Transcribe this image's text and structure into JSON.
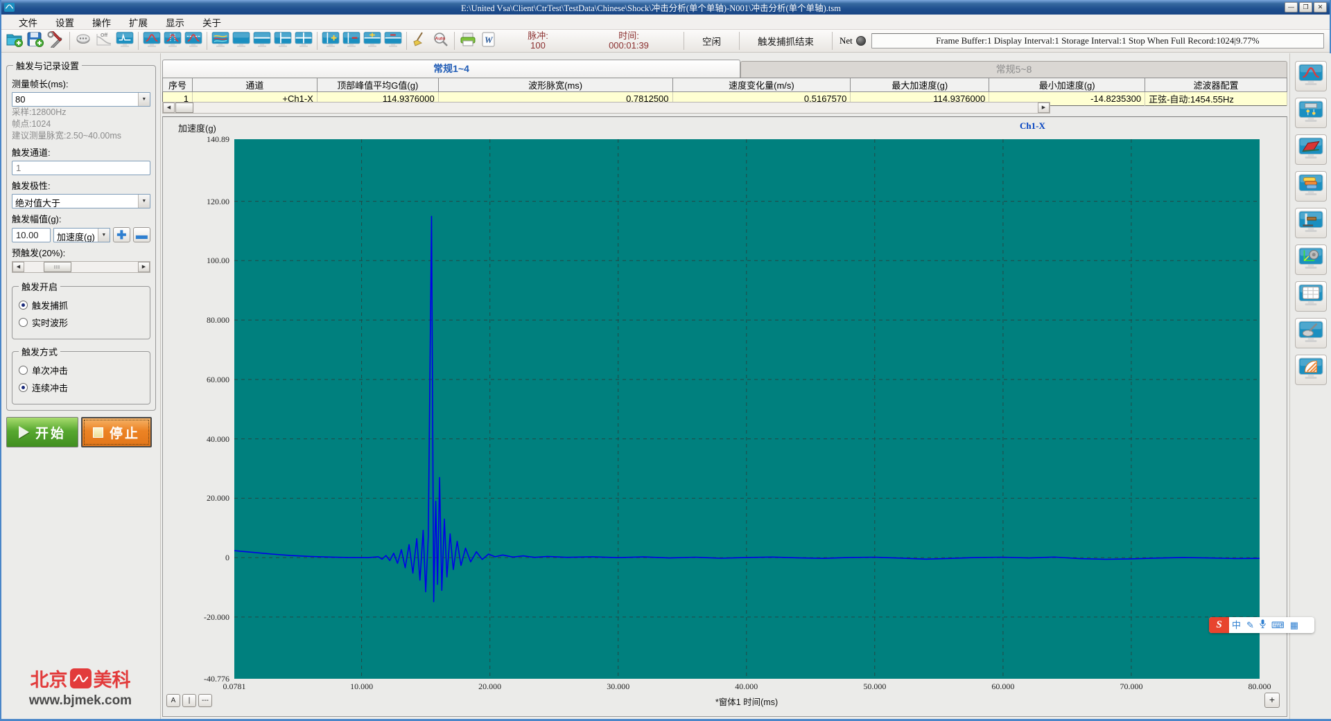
{
  "window": {
    "title": "E:\\United Vsa\\Client\\CtrTest\\TestData\\Chinese\\Shock\\冲击分析(单个单轴)-N001\\冲击分析(单个单轴).tsm",
    "buttons": {
      "minimize": "—",
      "maximize": "❒",
      "close": "✕"
    }
  },
  "menu": {
    "items": [
      "文件",
      "设置",
      "操作",
      "扩展",
      "显示",
      "关于"
    ]
  },
  "toolbar": {
    "buttons": [
      {
        "icon": "open-folder-icon",
        "name": "open-button"
      },
      {
        "icon": "save-icon",
        "name": "save-button"
      },
      {
        "icon": "tools-icon",
        "name": "config-tools-button"
      },
      {
        "sep": true
      },
      {
        "icon": "connector-icon",
        "name": "hardware-connect-button"
      },
      {
        "icon": "off-curve-icon",
        "name": "output-off-button"
      },
      {
        "icon": "scope-screen-icon",
        "name": "scope-window-button"
      },
      {
        "sep": true
      },
      {
        "icon": "peak-screen-icon",
        "name": "pulse-window-button"
      },
      {
        "icon": "peak-markers-screen-icon",
        "name": "pulse-cursor-window-button"
      },
      {
        "icon": "pulse-tolerance-screen-icon",
        "name": "pulse-tolerance-window-button"
      },
      {
        "sep": true
      },
      {
        "icon": "curves-screen-icon",
        "name": "multi-curve-window-button"
      },
      {
        "icon": "single-screen-icon",
        "name": "single-layout-button"
      },
      {
        "icon": "hsplit-screen-icon",
        "name": "hsplit-layout-button"
      },
      {
        "icon": "vsplit-screen-icon",
        "name": "vsplit-layout-button"
      },
      {
        "icon": "quad-screen-icon",
        "name": "quad-layout-button"
      },
      {
        "sep": true
      },
      {
        "icon": "add-window-icon",
        "name": "add-window-button"
      },
      {
        "icon": "remove-window-icon",
        "name": "remove-window-button"
      },
      {
        "icon": "add-pane-icon",
        "name": "add-pane-button"
      },
      {
        "icon": "remove-pane-icon",
        "name": "remove-pane-button"
      },
      {
        "sep": true
      },
      {
        "icon": "broom-icon",
        "name": "clear-button"
      },
      {
        "icon": "auto-zoom-icon",
        "name": "auto-scale-button"
      },
      {
        "sep": true
      },
      {
        "icon": "printer-icon",
        "name": "print-button"
      },
      {
        "icon": "word-export-icon",
        "name": "word-report-button"
      }
    ],
    "pulse": {
      "label": "脉冲:",
      "value": "100"
    },
    "time": {
      "label": "时间:",
      "value": "000:01:39"
    },
    "idle": "空闲",
    "trigger_status": "触发捕抓结束",
    "net_label": "Net",
    "status_text": "Frame Buffer:1  Display Interval:1 Storage Interval:1 Stop When Full Record:1024|9.77%"
  },
  "sidebar": {
    "group_title": "触发与记录设置",
    "frame_length_label": "测量帧长(ms):",
    "frame_length_value": "80",
    "info_lines": [
      "采样:12800Hz",
      "帧点:1024",
      "建议测量脉宽:2.50~40.00ms"
    ],
    "trigger_channel_label": "触发通道:",
    "trigger_channel_value": "1",
    "trigger_polarity_label": "触发极性:",
    "trigger_polarity_value": "绝对值大于",
    "trigger_amplitude_label": "触发幅值(g):",
    "trigger_amplitude_value": "10.00",
    "trigger_amplitude_unit": "加速度(g)",
    "pretrigger_label": "预触发(20%):",
    "trigger_enable_group": "触发开启",
    "trigger_enable_options": [
      {
        "label": "触发捕抓",
        "selected": true
      },
      {
        "label": "实时波形",
        "selected": false
      }
    ],
    "trigger_mode_group": "触发方式",
    "trigger_mode_options": [
      {
        "label": "单次冲击",
        "selected": false
      },
      {
        "label": "连续冲击",
        "selected": true
      }
    ],
    "start_button": "开始",
    "stop_button": "停止"
  },
  "tabs": [
    {
      "label": "常规1~4",
      "active": true
    },
    {
      "label": "常规5~8",
      "active": false
    }
  ],
  "table": {
    "headers": [
      "序号",
      "通道",
      "顶部峰值平均G值(g)",
      "波形脉宽(ms)",
      "速度变化量(m/s)",
      "最大加速度(g)",
      "最小加速度(g)",
      "滤波器配置"
    ],
    "rows": [
      [
        "1",
        "+Ch1-X",
        "114.9376000",
        "0.7812500",
        "0.5167570",
        "114.9376000",
        "-14.8235300",
        "正弦-自动:1454.55Hz"
      ]
    ]
  },
  "chart": {
    "y_axis_title": "加速度(g)",
    "x_axis_title": "*窗体1 时间(ms)",
    "legend": "Ch1-X",
    "corner_buttons": [
      "A",
      "|",
      "---"
    ],
    "zoom_button": "+"
  },
  "chart_data": {
    "type": "line",
    "title": "",
    "ylabel": "加速度(g)",
    "xlabel": "*窗体1 时间(ms)",
    "xlim": [
      0.0781,
      80
    ],
    "ylim": [
      -40.776,
      140.89
    ],
    "x_ticks": [
      "0.0781",
      "10.000",
      "20.000",
      "30.000",
      "40.000",
      "50.000",
      "60.000",
      "70.000",
      "80.000"
    ],
    "x_tick_values": [
      0.0781,
      10,
      20,
      30,
      40,
      50,
      60,
      70,
      80
    ],
    "y_ticks": [
      "140.89",
      "120.00",
      "100.00",
      "80.000",
      "60.000",
      "40.000",
      "20.000",
      "0",
      "-20.000",
      "-40.776"
    ],
    "y_tick_values": [
      140.89,
      120,
      100,
      80,
      60,
      40,
      20,
      0,
      -20,
      -40.776
    ],
    "grid": true,
    "plot_bg": "#00807e",
    "line_color": "#0000e8",
    "grid_color": "#27423f",
    "legend_position": "top-right",
    "series": [
      {
        "name": "Ch1-X",
        "points": [
          [
            0,
            2.4
          ],
          [
            1.5,
            1.8
          ],
          [
            3,
            1.2
          ],
          [
            4.5,
            0.7
          ],
          [
            6,
            0.4
          ],
          [
            7.5,
            0.2
          ],
          [
            9,
            0.05
          ],
          [
            10.5,
            0
          ],
          [
            11.3,
            0.3
          ],
          [
            11.6,
            -0.5
          ],
          [
            11.9,
            0.7
          ],
          [
            12.2,
            -1
          ],
          [
            12.5,
            1.5
          ],
          [
            12.8,
            -1.9
          ],
          [
            13.1,
            2.7
          ],
          [
            13.4,
            -3.4
          ],
          [
            13.7,
            4.4
          ],
          [
            14,
            -5.2
          ],
          [
            14.3,
            6.4
          ],
          [
            14.55,
            -7.6
          ],
          [
            14.8,
            9.2
          ],
          [
            15,
            -11.5
          ],
          [
            15.2,
            7
          ],
          [
            15.45,
            114.9376
          ],
          [
            15.62,
            -14.8235
          ],
          [
            15.78,
            19
          ],
          [
            15.92,
            -9
          ],
          [
            16.08,
            27
          ],
          [
            16.25,
            -11
          ],
          [
            16.45,
            13
          ],
          [
            16.65,
            -6.5
          ],
          [
            16.9,
            8
          ],
          [
            17.15,
            -4
          ],
          [
            17.45,
            5.5
          ],
          [
            17.75,
            -2.6
          ],
          [
            18.1,
            3.2
          ],
          [
            18.5,
            -1.4
          ],
          [
            18.95,
            2
          ],
          [
            19.4,
            -0.6
          ],
          [
            19.9,
            1.2
          ],
          [
            20.4,
            0.3
          ],
          [
            21,
            0.9
          ],
          [
            21.8,
            0.2
          ],
          [
            22.6,
            0.6
          ],
          [
            23.5,
            0.1
          ],
          [
            24.5,
            0.4
          ],
          [
            26,
            0.1
          ],
          [
            28,
            0.3
          ],
          [
            30,
            0
          ],
          [
            32,
            0.25
          ],
          [
            34,
            -0.1
          ],
          [
            36,
            0.15
          ],
          [
            38,
            -0.2
          ],
          [
            40,
            0.05
          ],
          [
            42,
            0.2
          ],
          [
            44,
            -0.05
          ],
          [
            46,
            -0.25
          ],
          [
            48,
            0.05
          ],
          [
            50,
            0.15
          ],
          [
            52,
            -0.15
          ],
          [
            54,
            -0.5
          ],
          [
            56,
            -0.25
          ],
          [
            58,
            0.05
          ],
          [
            60,
            0.15
          ],
          [
            62,
            -0.1
          ],
          [
            64,
            0.2
          ],
          [
            66,
            -0.35
          ],
          [
            68,
            -0.55
          ],
          [
            70,
            -0.4
          ],
          [
            72,
            -0.15
          ],
          [
            74,
            0.05
          ],
          [
            76,
            -0.1
          ],
          [
            78,
            -0.3
          ],
          [
            80,
            -0.25
          ]
        ]
      }
    ]
  },
  "right_toolbar": {
    "buttons": [
      {
        "icon": "pulse-analysis-screen-icon",
        "name": "pulse-analysis-view-button"
      },
      {
        "icon": "control-panel-screen-icon",
        "name": "control-panel-view-button"
      },
      {
        "icon": "waterfall-screen-icon",
        "name": "waterfall-view-button"
      },
      {
        "icon": "layers-screen-icon",
        "name": "layers-view-button"
      },
      {
        "icon": "fixture-screen-icon",
        "name": "fixture-view-button"
      },
      {
        "icon": "shaker-screen-icon",
        "name": "shaker-view-button"
      },
      {
        "icon": "table-screen-icon",
        "name": "table-view-button"
      },
      {
        "icon": "sensor-screen-icon",
        "name": "sensor-view-button"
      },
      {
        "icon": "shell-screen-icon",
        "name": "shell-view-button"
      }
    ]
  },
  "branding": {
    "logo_left": "北京",
    "logo_right": "美科",
    "url": "www.bjmek.com"
  },
  "ime": {
    "brand": "S",
    "icons": [
      "中",
      "✎",
      "⌨",
      "▦"
    ]
  },
  "colors": {
    "plot_background": "#00807e",
    "waveform": "#0000e8",
    "row_highlight": "#ffffd2",
    "start_button": "#4f9e29",
    "stop_button": "#ec8324",
    "titlebar": "#1f4f8f",
    "counter_text": "#8b3030"
  }
}
